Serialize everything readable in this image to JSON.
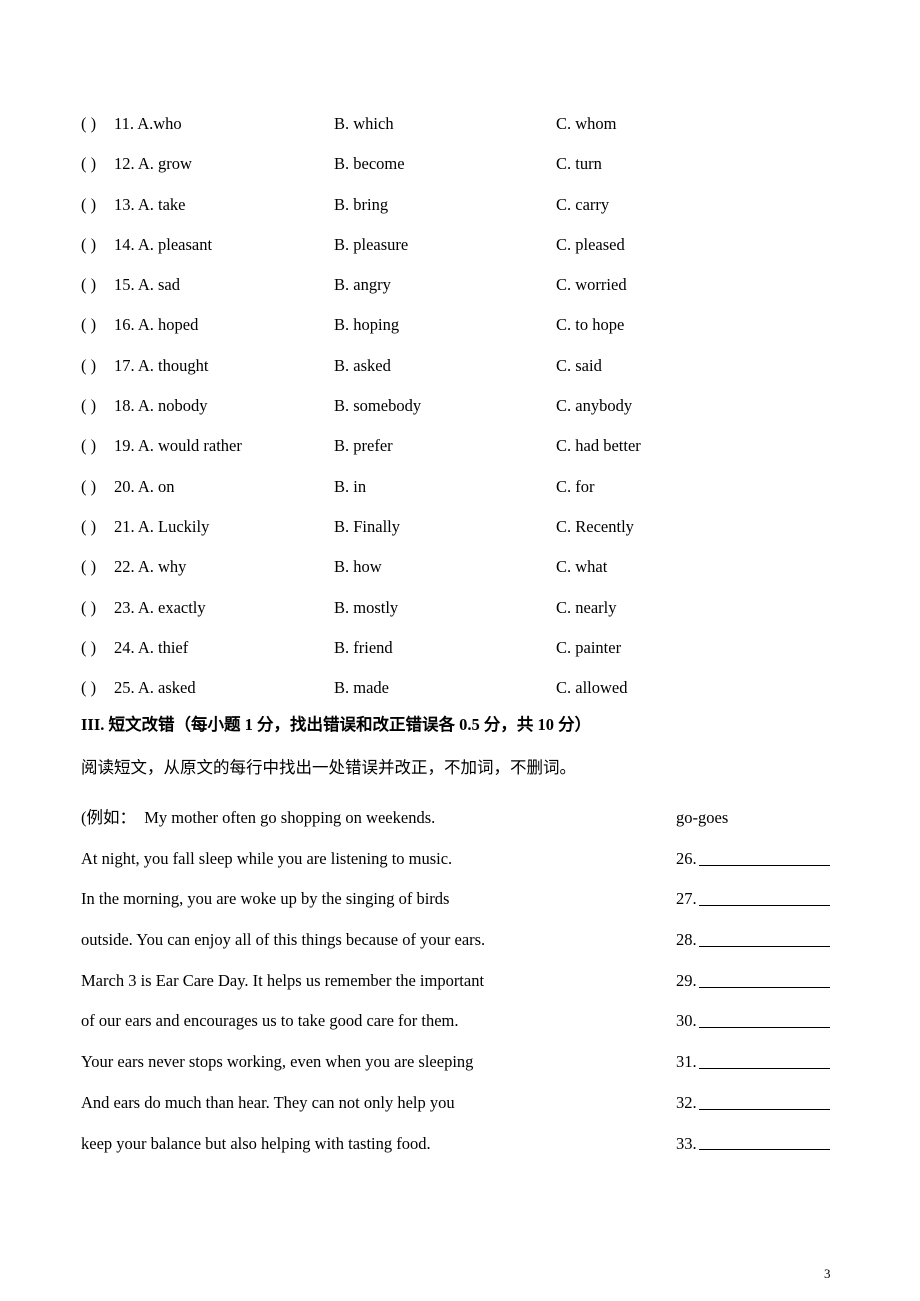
{
  "page": {
    "page_number": "3"
  },
  "cloze": {
    "paren_mark": "(     )",
    "items": [
      {
        "number": "11.",
        "a": "A.who",
        "b": "B. which",
        "c": "C. whom"
      },
      {
        "number": "12.",
        "a": "A. grow",
        "b": "B. become",
        "c": "C. turn"
      },
      {
        "number": "13.",
        "a": "A. take",
        "b": "B. bring",
        "c": "C. carry"
      },
      {
        "number": "14.",
        "a": "A. pleasant",
        "b": "B. pleasure",
        "c": "C. pleased"
      },
      {
        "number": "15.",
        "a": "A. sad",
        "b": "B. angry",
        "c": "C. worried"
      },
      {
        "number": "16.",
        "a": "A. hoped",
        "b": "B. hoping",
        "c": "C. to hope"
      },
      {
        "number": "17.",
        "a": "A. thought",
        "b": "B. asked",
        "c": "C. said"
      },
      {
        "number": "18.",
        "a": "A. nobody",
        "b": "B. somebody",
        "c": "C. anybody"
      },
      {
        "number": "19.",
        "a": "A. would rather",
        "b": "B. prefer",
        "c": "C. had better"
      },
      {
        "number": "20.",
        "a": "A. on",
        "b": "B. in",
        "c": "C. for"
      },
      {
        "number": "21.",
        "a": "A. Luckily",
        "b": "B. Finally",
        "c": "C. Recently"
      },
      {
        "number": "22.",
        "a": "A. why",
        "b": "B. how",
        "c": "C. what"
      },
      {
        "number": "23.",
        "a": "A. exactly",
        "b": "B. mostly",
        "c": "C. nearly"
      },
      {
        "number": "24.",
        "a": "A. thief",
        "b": "B. friend",
        "c": "C. painter"
      },
      {
        "number": "25.",
        "a": "A. asked",
        "b": "B. made",
        "c": "C. allowed"
      }
    ]
  },
  "proofreading": {
    "heading": "III. 短文改错（每小题 1 分，找出错误和改正错误各 0.5 分，共 10 分）",
    "instruction": "阅读短文，从原文的每行中找出一处错误并改正，不加词，不删词。",
    "example_line": "(例如：　My mother often go shopping on weekends.",
    "example_answer": "go-goes",
    "lines": [
      "At night, you fall sleep while you are listening to music.",
      "In the morning, you are woke up by the singing of birds",
      "outside. You can enjoy all of this things because of your ears.",
      "March 3 is Ear Care Day. It helps us remember the important",
      "of our ears and encourages us to take good care for them.",
      "Your ears never stops working, even when you are sleeping",
      "And ears do much than hear. They can not only help you",
      "keep your balance but also helping with tasting food."
    ],
    "answer_numbers": [
      "26.",
      "27.",
      "28.",
      "29.",
      "30.",
      "31.",
      "32.",
      "33."
    ]
  }
}
